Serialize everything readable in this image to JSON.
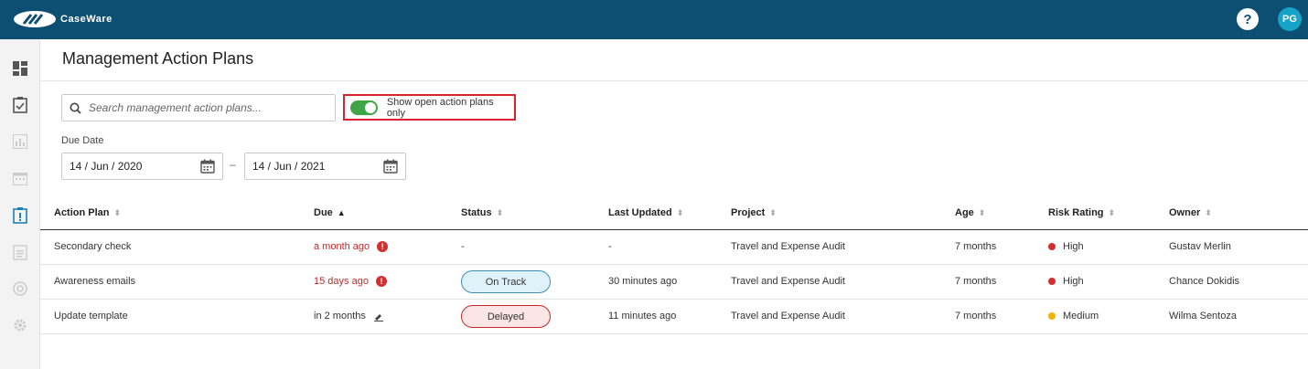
{
  "app": {
    "brand": "CaseWare",
    "help_label": "?",
    "user_initials": "PG"
  },
  "sidebar": {
    "items": [
      {
        "icon": "dashboard-icon"
      },
      {
        "icon": "checklist-icon"
      },
      {
        "icon": "chart-icon"
      },
      {
        "icon": "calendar-icon"
      },
      {
        "icon": "alert-icon"
      },
      {
        "icon": "clipboard-icon"
      },
      {
        "icon": "globe-icon"
      },
      {
        "icon": "gear-icon"
      }
    ]
  },
  "page": {
    "title": "Management Action Plans"
  },
  "search": {
    "placeholder": "Search management action plans..."
  },
  "filter": {
    "toggle_label": "Show open action plans only",
    "toggle_on": true
  },
  "due_date": {
    "label": "Due Date",
    "from": "14 / Jun / 2020",
    "separator": "–",
    "to": "14 / Jun / 2021"
  },
  "table": {
    "columns": [
      "Action Plan",
      "Due",
      "Status",
      "Last Updated",
      "Project",
      "Age",
      "Risk Rating",
      "Owner"
    ],
    "rows": [
      {
        "action_plan": "Secondary check",
        "due": "a month ago",
        "status": "-",
        "last_updated": "-",
        "project": "Travel and Expense Audit",
        "age": "7 months",
        "risk": "High",
        "owner": "Gustav Merlin"
      },
      {
        "action_plan": "Awareness emails",
        "due": "15 days ago",
        "status": "On Track",
        "last_updated": "30 minutes ago",
        "project": "Travel and Expense Audit",
        "age": "7 months",
        "risk": "High",
        "owner": "Chance Dokidis"
      },
      {
        "action_plan": "Update template",
        "due": "in 2 months",
        "status": "Delayed",
        "last_updated": "11 minutes ago",
        "project": "Travel and Expense Audit",
        "age": "7 months",
        "risk": "Medium",
        "owner": "Wilma Sentoza"
      }
    ]
  },
  "colors": {
    "topbar": "#0d4f73",
    "high": "#d32f2f",
    "medium": "#f0b400",
    "toggle_on": "#3fa648"
  }
}
